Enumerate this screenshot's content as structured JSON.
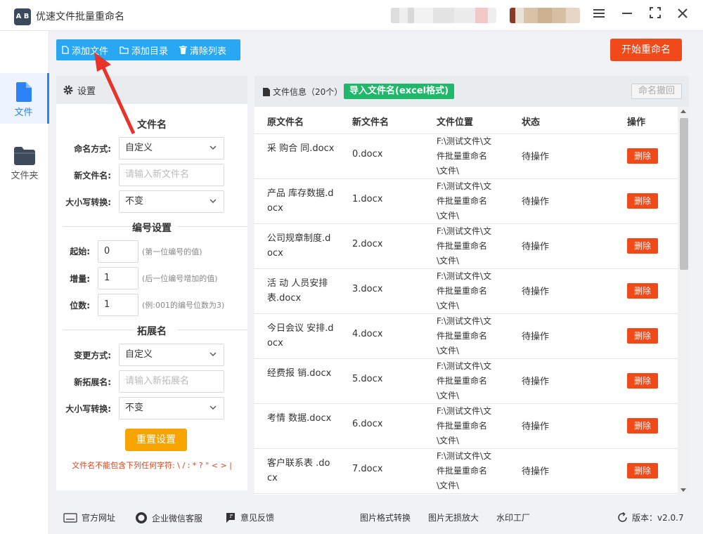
{
  "app": {
    "title": "优速文件批量重命名",
    "logo": "A B"
  },
  "nav": [
    {
      "label": "文件",
      "icon": "file-icon",
      "active": true
    },
    {
      "label": "文件夹",
      "icon": "folder-icon",
      "active": false
    }
  ],
  "toolbar": {
    "add_file": "添加文件",
    "add_dir": "添加目录",
    "clear_list": "清除列表",
    "start": "开始重命名"
  },
  "settings": {
    "header": "设置",
    "filename_section": "文件名",
    "naming_mode_label": "命名方式:",
    "naming_mode_value": "自定义",
    "new_name_label": "新文件名:",
    "new_name_placeholder": "请输入新文件名",
    "case_label": "大小写转换:",
    "case_value": "不变",
    "numbering_section": "编号设置",
    "start_label": "起始:",
    "start_value": "0",
    "start_hint": "(第一位编号的值)",
    "step_label": "增量:",
    "step_value": "1",
    "step_hint": "(后一位编号增加的值)",
    "digits_label": "位数:",
    "digits_value": "1",
    "digits_hint": "(例:001的编号位数为3)",
    "ext_section": "拓展名",
    "ext_mode_label": "变更方式:",
    "ext_mode_value": "自定义",
    "new_ext_label": "新拓展名:",
    "new_ext_placeholder": "请输入新拓展名",
    "ext_case_label": "大小写转换:",
    "ext_case_value": "不变",
    "reset": "重置设置",
    "warning": "文件名不能包含下列任何字符: \\ / : * ? \" < > |"
  },
  "files": {
    "title": "文件信息（20个）",
    "import_btn": "导入文件名(excel格式)",
    "undo_btn": "命名撤回",
    "columns": [
      "原文件名",
      "新文件名",
      "文件位置",
      "状态",
      "操作"
    ],
    "rows": [
      {
        "orig": "采 购合 同.docx",
        "new": "0.docx",
        "loc": "F:\\测试文件\\文件批量重命名\\文件\\",
        "status": "待操作",
        "action": "删除"
      },
      {
        "orig": "产品 库存数据.docx",
        "new": "1.docx",
        "loc": "F:\\测试文件\\文件批量重命名\\文件\\",
        "status": "待操作",
        "action": "删除"
      },
      {
        "orig": "公司规章制度.docx",
        "new": "2.docx",
        "loc": "F:\\测试文件\\文件批量重命名\\文件\\",
        "status": "待操作",
        "action": "删除"
      },
      {
        "orig": "活 动 人员安排表.docx",
        "new": "3.docx",
        "loc": "F:\\测试文件\\文件批量重命名\\文件\\",
        "status": "待操作",
        "action": "删除"
      },
      {
        "orig": "今日会议 安排.docx",
        "new": "4.docx",
        "loc": "F:\\测试文件\\文件批量重命名\\文件\\",
        "status": "待操作",
        "action": "删除"
      },
      {
        "orig": "经费报 销.docx",
        "new": "5.docx",
        "loc": "F:\\测试文件\\文件批量重命名\\文件\\",
        "status": "待操作",
        "action": "删除"
      },
      {
        "orig": "考情 数据.docx",
        "new": "6.docx",
        "loc": "F:\\测试文件\\文件批量重命名\\文件\\",
        "status": "待操作",
        "action": "删除"
      },
      {
        "orig": "客户联系表 .docx",
        "new": "7.docx",
        "loc": "F:\\测试文件\\文件批量重命名\\文件\\",
        "status": "待操作",
        "action": "删除"
      }
    ]
  },
  "footer": {
    "website": "官方网址",
    "wechat": "企业微信客服",
    "feedback": "意见反馈",
    "img_convert": "图片格式转换",
    "img_upscale": "图片无损放大",
    "watermark": "水印工厂",
    "version": "版本：v2.0.7"
  },
  "colors": {
    "accent": "#2b83f6",
    "toolbar": "#2aa7f3",
    "danger": "#f04a1a",
    "success": "#1fb86b",
    "warning": "#f7a400"
  }
}
